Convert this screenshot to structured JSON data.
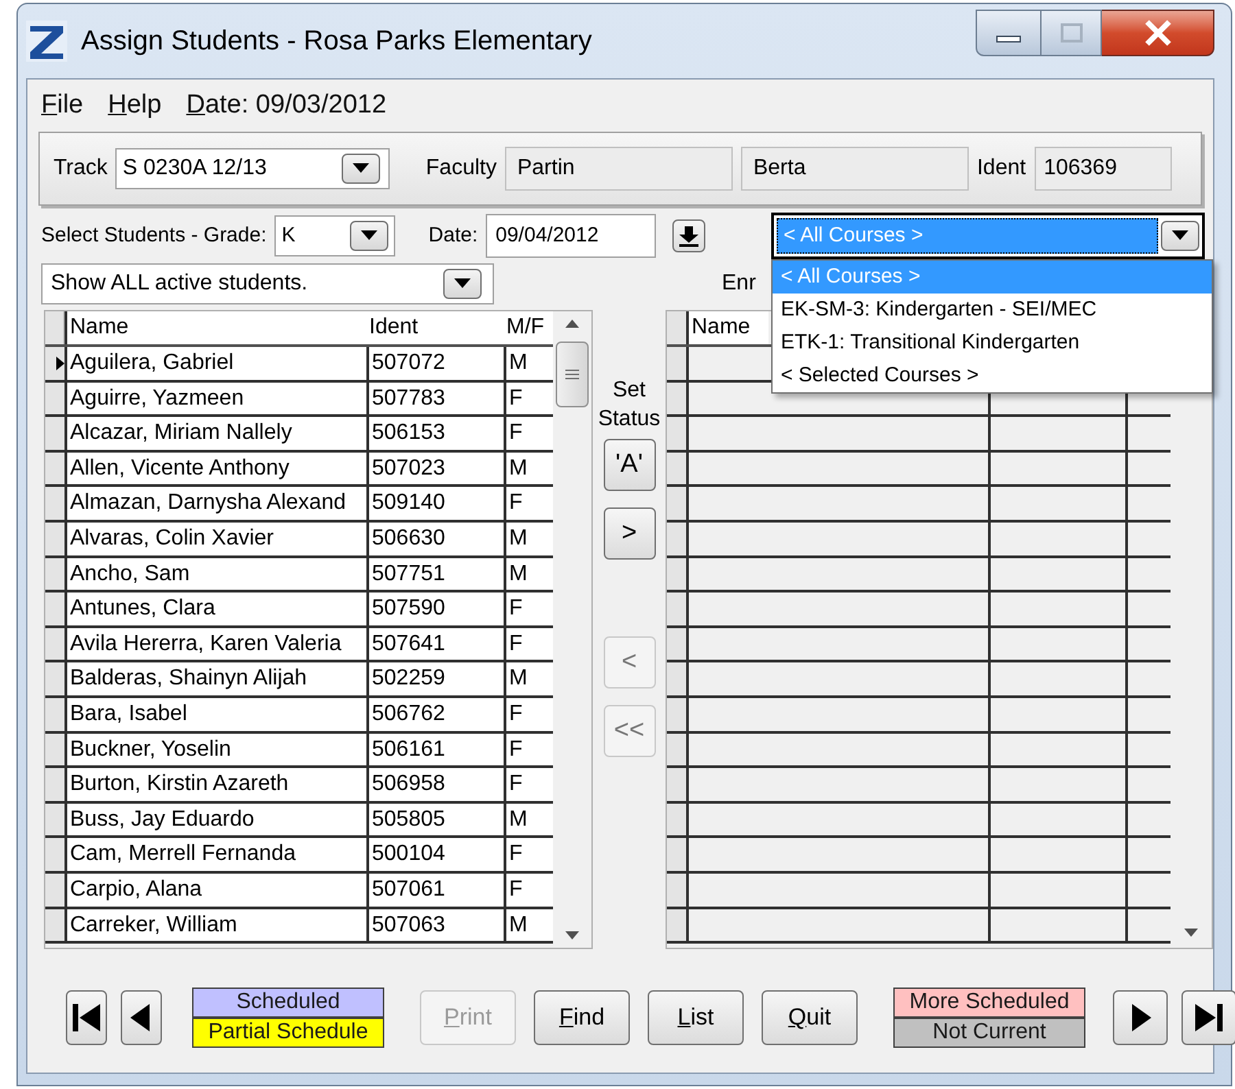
{
  "window": {
    "title": "Assign Students - Rosa Parks Elementary"
  },
  "menu": [
    {
      "label": "File"
    },
    {
      "label": "Help"
    },
    {
      "label": "Date: 09/03/2012"
    }
  ],
  "track": {
    "label": "Track",
    "value": "S 0230A 12/13"
  },
  "faculty": {
    "label": "Faculty",
    "last_name": "Partin",
    "first_name": "Berta",
    "ident_label": "Ident",
    "ident": "106369"
  },
  "grade": {
    "label": "Select Students - Grade:",
    "value": "K"
  },
  "date": {
    "label": "Date:",
    "value": "09/04/2012"
  },
  "course_select": {
    "value": "< All Courses >",
    "expanded": true,
    "options": [
      {
        "label": "< All Courses >",
        "selected": true
      },
      {
        "label": "EK-SM-3: Kindergarten - SEI/MEC",
        "selected": false
      },
      {
        "label": "ETK-1: Transitional Kindergarten",
        "selected": false
      },
      {
        "label": "< Selected Courses >",
        "selected": false
      }
    ]
  },
  "filter": {
    "value": "Show ALL active students."
  },
  "enrolled_label": "Enr",
  "students": {
    "columns": [
      "Name",
      "Ident",
      "M/F"
    ],
    "rows": [
      {
        "name": "Aguilera, Gabriel",
        "ident": "507072",
        "sex": "M",
        "selected": true
      },
      {
        "name": "Aguirre, Yazmeen",
        "ident": "507783",
        "sex": "F",
        "selected": false
      },
      {
        "name": "Alcazar, Miriam Nallely",
        "ident": "506153",
        "sex": "F",
        "selected": false
      },
      {
        "name": "Allen, Vicente Anthony",
        "ident": "507023",
        "sex": "M",
        "selected": false
      },
      {
        "name": "Almazan, Darnysha Alexand",
        "ident": "509140",
        "sex": "F",
        "selected": false
      },
      {
        "name": "Alvaras, Colin Xavier",
        "ident": "506630",
        "sex": "M",
        "selected": false
      },
      {
        "name": "Ancho, Sam",
        "ident": "507751",
        "sex": "M",
        "selected": false
      },
      {
        "name": "Antunes, Clara",
        "ident": "507590",
        "sex": "F",
        "selected": false
      },
      {
        "name": "Avila Hererra, Karen Valeria",
        "ident": "507641",
        "sex": "F",
        "selected": false
      },
      {
        "name": "Balderas, Shainyn Alijah",
        "ident": "502259",
        "sex": "M",
        "selected": false
      },
      {
        "name": "Bara, Isabel",
        "ident": "506762",
        "sex": "F",
        "selected": false
      },
      {
        "name": "Buckner, Yoselin",
        "ident": "506161",
        "sex": "F",
        "selected": false
      },
      {
        "name": "Burton, Kirstin Azareth",
        "ident": "506958",
        "sex": "F",
        "selected": false
      },
      {
        "name": "Buss, Jay Eduardo",
        "ident": "505805",
        "sex": "M",
        "selected": false
      },
      {
        "name": "Cam, Merrell Fernanda",
        "ident": "500104",
        "sex": "F",
        "selected": false
      },
      {
        "name": "Carpio, Alana",
        "ident": "507061",
        "sex": "F",
        "selected": false
      },
      {
        "name": "Carreker, William",
        "ident": "507063",
        "sex": "M",
        "selected": false
      }
    ]
  },
  "set_status": {
    "label": "Set Status",
    "buttons": [
      {
        "label": "'A'",
        "disabled": false
      },
      {
        "label": ">",
        "disabled": false
      },
      {
        "label": "<",
        "disabled": true
      },
      {
        "label": "<<",
        "disabled": true
      }
    ]
  },
  "enrolled": {
    "columns": [
      "Name"
    ]
  },
  "legend_left": [
    {
      "label": "Scheduled",
      "color": "#c0c0ff"
    },
    {
      "label": "Partial Schedule",
      "color": "#ffff00"
    }
  ],
  "buttons": [
    {
      "label": "Print",
      "disabled": true
    },
    {
      "label": "Find",
      "disabled": false
    },
    {
      "label": "List",
      "disabled": false
    },
    {
      "label": "Quit",
      "disabled": false
    }
  ],
  "legend_right": [
    {
      "label": "More Scheduled",
      "color": "#ffc0c0"
    },
    {
      "label": "Not Current",
      "color": "#c0c0c0"
    }
  ]
}
